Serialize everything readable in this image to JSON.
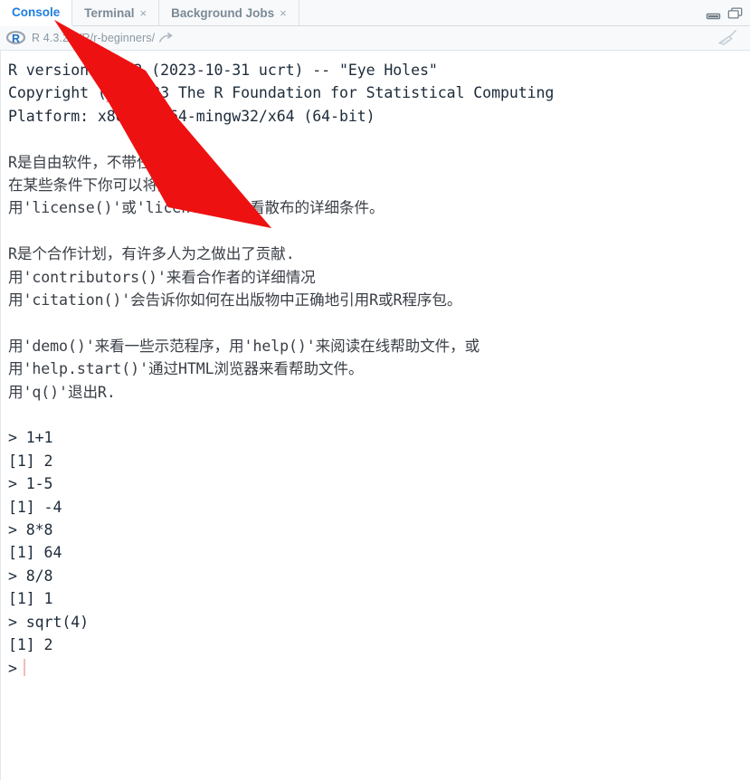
{
  "window": {
    "minimize_label": "Minimize",
    "maximize_label": "Maximize"
  },
  "tabs": [
    {
      "label": "Console",
      "active": true,
      "closable": false
    },
    {
      "label": "Terminal",
      "active": false,
      "closable": true,
      "close_glyph": "×"
    },
    {
      "label": "Background Jobs",
      "active": false,
      "closable": true,
      "close_glyph": "×"
    }
  ],
  "pathbar": {
    "logo_letter": "R",
    "path": "R 4.3.2 ~/R/r-beginners/",
    "broom_title": "Clear console",
    "open_arrow_title": "Show in new window"
  },
  "console": {
    "lines": [
      {
        "text": "R version 4.3.2 (2023-10-31 ucrt) -- \"Eye Holes\"",
        "kind": "mono"
      },
      {
        "text": "Copyright (C) 2023 The R Foundation for Statistical Computing",
        "kind": "mono"
      },
      {
        "text": "Platform: x86_64-w64-mingw32/x64 (64-bit)",
        "kind": "mono"
      },
      {
        "text": "",
        "kind": "blank"
      },
      {
        "text": "R是自由软件，不带任何担保。",
        "kind": "cn"
      },
      {
        "text": "在某些条件下你可以将其自由散布。",
        "kind": "cn"
      },
      {
        "text": "用'license()'或'licence()'来看散布的详细条件。",
        "kind": "cn"
      },
      {
        "text": "",
        "kind": "blank"
      },
      {
        "text": "R是个合作计划，有许多人为之做出了贡献.",
        "kind": "cn"
      },
      {
        "text": "用'contributors()'来看合作者的详细情况",
        "kind": "cn"
      },
      {
        "text": "用'citation()'会告诉你如何在出版物中正确地引用R或R程序包。",
        "kind": "cn"
      },
      {
        "text": "",
        "kind": "blank"
      },
      {
        "text": "用'demo()'来看一些示范程序，用'help()'来阅读在线帮助文件，或",
        "kind": "cn"
      },
      {
        "text": "用'help.start()'通过HTML浏览器来看帮助文件。",
        "kind": "cn"
      },
      {
        "text": "用'q()'退出R.",
        "kind": "cn"
      },
      {
        "text": "",
        "kind": "blank"
      },
      {
        "text": "> 1+1",
        "kind": "mono"
      },
      {
        "text": "[1] 2",
        "kind": "mono"
      },
      {
        "text": "> 1-5",
        "kind": "mono"
      },
      {
        "text": "[1] -4",
        "kind": "mono"
      },
      {
        "text": "> 8*8",
        "kind": "mono"
      },
      {
        "text": "[1] 64",
        "kind": "mono"
      },
      {
        "text": "> 8/8",
        "kind": "mono"
      },
      {
        "text": "[1] 1",
        "kind": "mono"
      },
      {
        "text": "> sqrt(4)",
        "kind": "mono"
      },
      {
        "text": "[1] 2",
        "kind": "mono"
      }
    ],
    "prompt_symbol": ">",
    "session": [
      {
        "input": "1+1",
        "output": "[1] 2"
      },
      {
        "input": "1-5",
        "output": "[1] -4"
      },
      {
        "input": "8*8",
        "output": "[1] 64"
      },
      {
        "input": "8/8",
        "output": "[1] 1"
      },
      {
        "input": "sqrt(4)",
        "output": "[1] 2"
      }
    ]
  },
  "annotation": {
    "arrow_color": "#ee1111",
    "points_at": "Console"
  },
  "colors": {
    "accent": "#1f7ee0",
    "tab_inactive_text": "#7c8a95",
    "console_text": "#1d2b3a",
    "toolbar_bg": "#f7f9fb",
    "cursor": "#f6b9b9"
  }
}
